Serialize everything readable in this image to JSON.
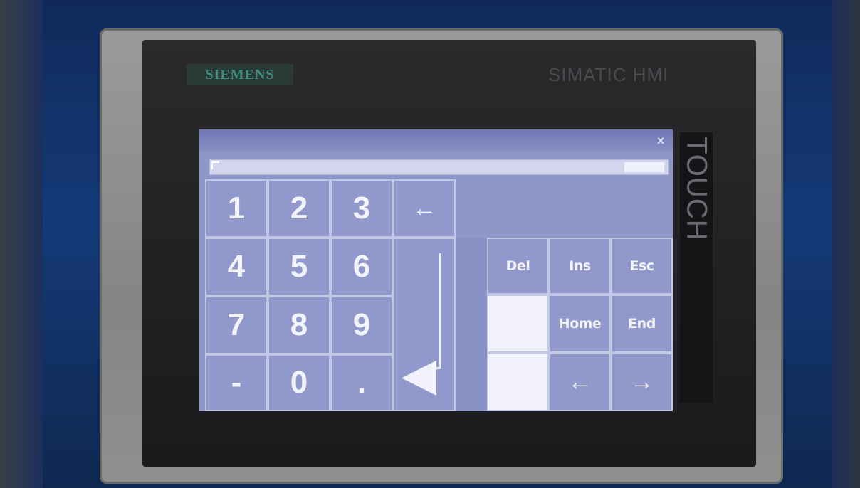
{
  "device": {
    "brand": "SIEMENS",
    "model": "SIMATIC HMI",
    "side_label": "TOUCH"
  },
  "window": {
    "close_label": "×"
  },
  "numpad": {
    "rows": [
      [
        "1",
        "2",
        "3"
      ],
      [
        "4",
        "5",
        "6"
      ],
      [
        "7",
        "8",
        "9"
      ],
      [
        "-",
        "0",
        "."
      ]
    ],
    "backspace_label": "←",
    "enter_label": "◀"
  },
  "nav": {
    "del": "Del",
    "ins": "Ins",
    "esc": "Esc",
    "home": "Home",
    "end": "End",
    "left": "←",
    "right": "→"
  },
  "colors": {
    "screen_bg": "#8f96c8",
    "key_border": "#c3c7e6",
    "bezel": "#8f8f8f",
    "brand_green": "#3d8f80"
  }
}
